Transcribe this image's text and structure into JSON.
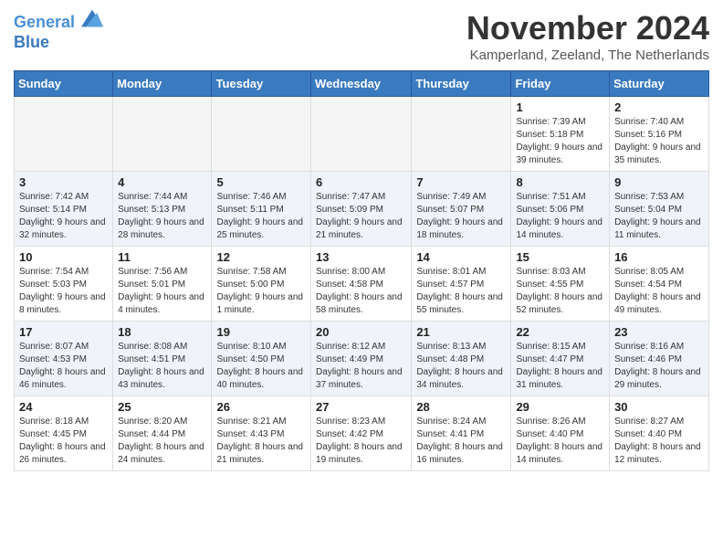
{
  "header": {
    "logo_line1": "General",
    "logo_line2": "Blue",
    "month": "November 2024",
    "location": "Kamperland, Zeeland, The Netherlands"
  },
  "weekdays": [
    "Sunday",
    "Monday",
    "Tuesday",
    "Wednesday",
    "Thursday",
    "Friday",
    "Saturday"
  ],
  "weeks": [
    [
      {
        "day": "",
        "info": ""
      },
      {
        "day": "",
        "info": ""
      },
      {
        "day": "",
        "info": ""
      },
      {
        "day": "",
        "info": ""
      },
      {
        "day": "",
        "info": ""
      },
      {
        "day": "1",
        "info": "Sunrise: 7:39 AM\nSunset: 5:18 PM\nDaylight: 9 hours and 39 minutes."
      },
      {
        "day": "2",
        "info": "Sunrise: 7:40 AM\nSunset: 5:16 PM\nDaylight: 9 hours and 35 minutes."
      }
    ],
    [
      {
        "day": "3",
        "info": "Sunrise: 7:42 AM\nSunset: 5:14 PM\nDaylight: 9 hours and 32 minutes."
      },
      {
        "day": "4",
        "info": "Sunrise: 7:44 AM\nSunset: 5:13 PM\nDaylight: 9 hours and 28 minutes."
      },
      {
        "day": "5",
        "info": "Sunrise: 7:46 AM\nSunset: 5:11 PM\nDaylight: 9 hours and 25 minutes."
      },
      {
        "day": "6",
        "info": "Sunrise: 7:47 AM\nSunset: 5:09 PM\nDaylight: 9 hours and 21 minutes."
      },
      {
        "day": "7",
        "info": "Sunrise: 7:49 AM\nSunset: 5:07 PM\nDaylight: 9 hours and 18 minutes."
      },
      {
        "day": "8",
        "info": "Sunrise: 7:51 AM\nSunset: 5:06 PM\nDaylight: 9 hours and 14 minutes."
      },
      {
        "day": "9",
        "info": "Sunrise: 7:53 AM\nSunset: 5:04 PM\nDaylight: 9 hours and 11 minutes."
      }
    ],
    [
      {
        "day": "10",
        "info": "Sunrise: 7:54 AM\nSunset: 5:03 PM\nDaylight: 9 hours and 8 minutes."
      },
      {
        "day": "11",
        "info": "Sunrise: 7:56 AM\nSunset: 5:01 PM\nDaylight: 9 hours and 4 minutes."
      },
      {
        "day": "12",
        "info": "Sunrise: 7:58 AM\nSunset: 5:00 PM\nDaylight: 9 hours and 1 minute."
      },
      {
        "day": "13",
        "info": "Sunrise: 8:00 AM\nSunset: 4:58 PM\nDaylight: 8 hours and 58 minutes."
      },
      {
        "day": "14",
        "info": "Sunrise: 8:01 AM\nSunset: 4:57 PM\nDaylight: 8 hours and 55 minutes."
      },
      {
        "day": "15",
        "info": "Sunrise: 8:03 AM\nSunset: 4:55 PM\nDaylight: 8 hours and 52 minutes."
      },
      {
        "day": "16",
        "info": "Sunrise: 8:05 AM\nSunset: 4:54 PM\nDaylight: 8 hours and 49 minutes."
      }
    ],
    [
      {
        "day": "17",
        "info": "Sunrise: 8:07 AM\nSunset: 4:53 PM\nDaylight: 8 hours and 46 minutes."
      },
      {
        "day": "18",
        "info": "Sunrise: 8:08 AM\nSunset: 4:51 PM\nDaylight: 8 hours and 43 minutes."
      },
      {
        "day": "19",
        "info": "Sunrise: 8:10 AM\nSunset: 4:50 PM\nDaylight: 8 hours and 40 minutes."
      },
      {
        "day": "20",
        "info": "Sunrise: 8:12 AM\nSunset: 4:49 PM\nDaylight: 8 hours and 37 minutes."
      },
      {
        "day": "21",
        "info": "Sunrise: 8:13 AM\nSunset: 4:48 PM\nDaylight: 8 hours and 34 minutes."
      },
      {
        "day": "22",
        "info": "Sunrise: 8:15 AM\nSunset: 4:47 PM\nDaylight: 8 hours and 31 minutes."
      },
      {
        "day": "23",
        "info": "Sunrise: 8:16 AM\nSunset: 4:46 PM\nDaylight: 8 hours and 29 minutes."
      }
    ],
    [
      {
        "day": "24",
        "info": "Sunrise: 8:18 AM\nSunset: 4:45 PM\nDaylight: 8 hours and 26 minutes."
      },
      {
        "day": "25",
        "info": "Sunrise: 8:20 AM\nSunset: 4:44 PM\nDaylight: 8 hours and 24 minutes."
      },
      {
        "day": "26",
        "info": "Sunrise: 8:21 AM\nSunset: 4:43 PM\nDaylight: 8 hours and 21 minutes."
      },
      {
        "day": "27",
        "info": "Sunrise: 8:23 AM\nSunset: 4:42 PM\nDaylight: 8 hours and 19 minutes."
      },
      {
        "day": "28",
        "info": "Sunrise: 8:24 AM\nSunset: 4:41 PM\nDaylight: 8 hours and 16 minutes."
      },
      {
        "day": "29",
        "info": "Sunrise: 8:26 AM\nSunset: 4:40 PM\nDaylight: 8 hours and 14 minutes."
      },
      {
        "day": "30",
        "info": "Sunrise: 8:27 AM\nSunset: 4:40 PM\nDaylight: 8 hours and 12 minutes."
      }
    ]
  ]
}
